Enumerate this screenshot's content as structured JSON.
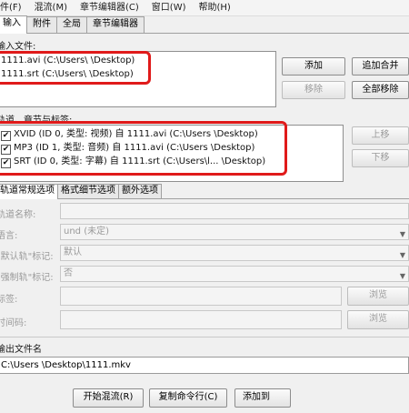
{
  "menu": [
    "件(F)",
    "混流(M)",
    "章节编辑器(C)",
    "窗口(W)",
    "帮助(H)"
  ],
  "tabs": [
    "输入",
    "附件",
    "全局",
    "章节编辑器"
  ],
  "input_files": {
    "label": "输入文件:",
    "files": [
      "1111.avi (C:\\Users\\        \\Desktop)",
      "1111.srt (C:\\Users\\        \\Desktop)"
    ],
    "buttons": {
      "add": "添加",
      "append": "追加合并",
      "remove": "移除",
      "remove_all": "全部移除"
    }
  },
  "tracks": {
    "label": "轨道、章节与标签:",
    "items": [
      "XVID (ID 0, 类型: 视频) 自 1111.avi (C:\\Users        \\Desktop)",
      "MP3 (ID 1, 类型: 音频) 自 1111.avi (C:\\Users        \\Desktop)",
      "SRT (ID 0, 类型: 字幕) 自 1111.srt (C:\\Users\\l...       \\Desktop)"
    ],
    "buttons": {
      "up": "上移",
      "down": "下移"
    }
  },
  "subtabs": [
    "轨道常规选项",
    "格式细节选项",
    "额外选项"
  ],
  "options": {
    "track_name": {
      "label": "轨道名称:",
      "value": ""
    },
    "language": {
      "label": "语言:",
      "value": "und (未定)"
    },
    "default_flag": {
      "label": "\"默认轨\"标记:",
      "value": "默认"
    },
    "forced_flag": {
      "label": "\"强制轨\"标记:",
      "value": "否"
    },
    "tags": {
      "label": "标签:",
      "browse": "浏览"
    },
    "timecodes": {
      "label": "时间码:",
      "browse": "浏览"
    }
  },
  "output": {
    "label": "输出文件名",
    "value": "C:\\Users       \\Desktop\\1111.mkv"
  },
  "actions": {
    "start": "开始混流(R)",
    "copy_cmd": "复制命令行(C)",
    "add_job": "添加到"
  }
}
